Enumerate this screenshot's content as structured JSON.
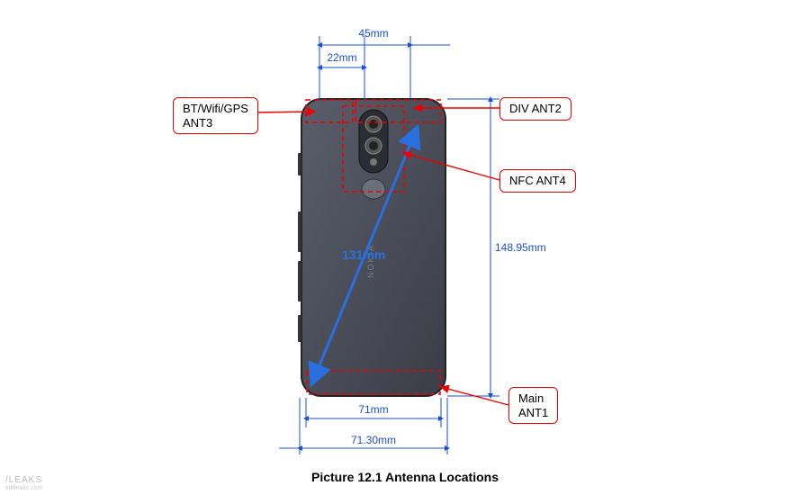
{
  "caption": "Picture 12.1 Antenna Locations",
  "watermark": "/LEAKS",
  "watermark_sub": "stillleaks.com",
  "dimensions": {
    "top_small": "22mm",
    "top_large": "45mm",
    "height": "148.95mm",
    "diag": "131mm",
    "width_inner": "71mm",
    "width_outer": "71.30mm"
  },
  "callouts": {
    "ant3_line1": "BT/Wifi/GPS",
    "ant3_line2": "ANT3",
    "ant2": "DIV ANT2",
    "ant4": "NFC ANT4",
    "ant1_line1": "Main",
    "ant1_line2": "ANT1"
  }
}
